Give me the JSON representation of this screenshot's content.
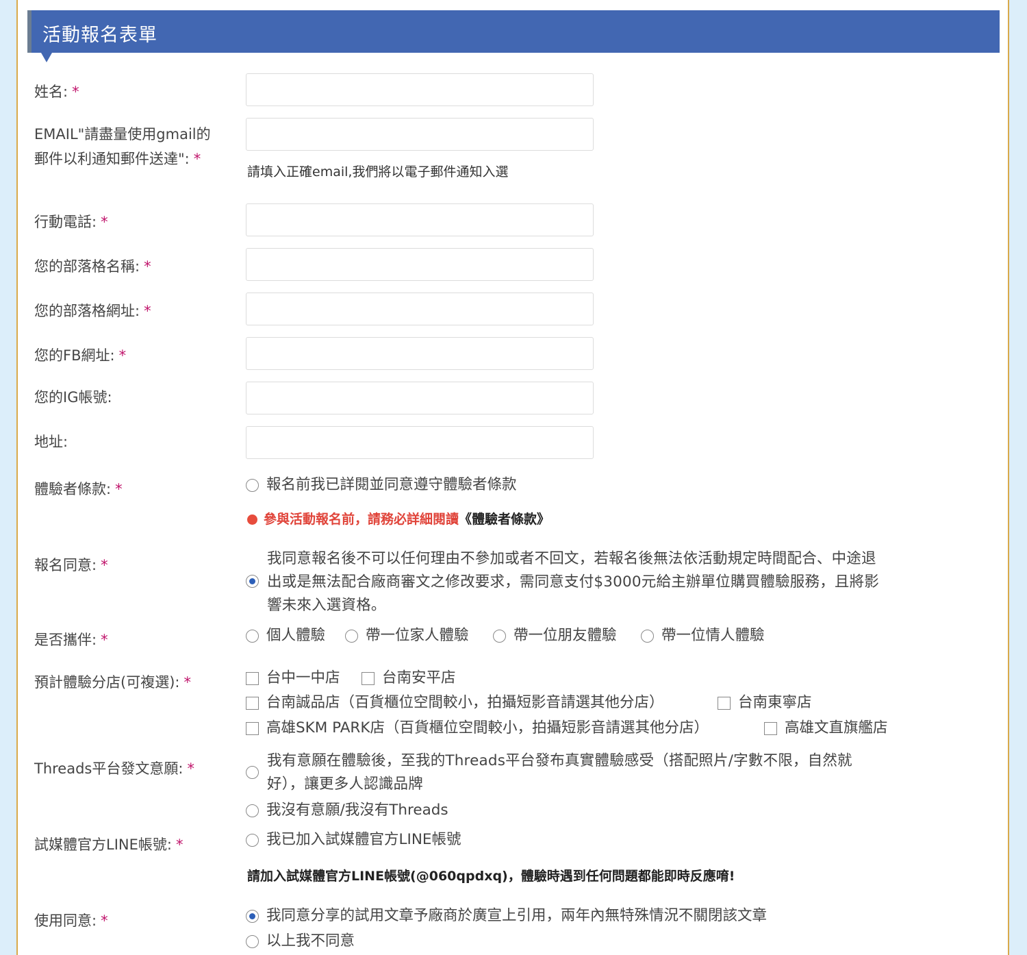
{
  "form": {
    "title": "活動報名表單",
    "required_mark": "*",
    "fields": {
      "name": {
        "label": "姓名:"
      },
      "email": {
        "label_line1": "EMAIL\"請盡量使用gmail的",
        "label_line2": "郵件以利通知郵件送達\":",
        "help": "請填入正確email,我們將以電子郵件通知入選"
      },
      "phone": {
        "label": "行動電話:"
      },
      "blog_name": {
        "label": "您的部落格名稱:"
      },
      "blog_url": {
        "label": "您的部落格網址:"
      },
      "fb_url": {
        "label": "您的FB網址:"
      },
      "ig": {
        "label": "您的IG帳號:"
      },
      "address": {
        "label": "地址:"
      }
    },
    "terms": {
      "label": "體驗者條款:",
      "option": "報名前我已詳閱並同意遵守體驗者條款",
      "warning": "參與活動報名前，請務必詳細閱讀",
      "link": "《體驗者條款》",
      "checked": false
    },
    "consent": {
      "label": "報名同意:",
      "line1": "我同意報名後不可以任何理由不參加或者不回文，若報名後無法依活動規定時間配合、中途退",
      "line2": "出或是無法配合廠商審文之修改要求，需同意支付$3000元給主辦單位購買體驗服務，且將影",
      "line3": "響未來入選資格。",
      "checked": true
    },
    "companion": {
      "label": "是否攜伴:",
      "options": [
        "個人體驗",
        "帶一位家人體驗",
        "帶一位朋友體驗",
        "帶一位情人體驗"
      ]
    },
    "stores": {
      "label": "預計體驗分店(可複選):",
      "options": [
        "台中一中店",
        "台南安平店",
        "台南誠品店（百貨櫃位空間較小，拍攝短影音請選其他分店）",
        "台南東寧店",
        "高雄SKM PARK店（百貨櫃位空間較小，拍攝短影音請選其他分店）",
        "高雄文直旗艦店"
      ]
    },
    "threads": {
      "label": "Threads平台發文意願:",
      "option1_line1": "我有意願在體驗後，至我的Threads平台發布真實體驗感受（搭配照片/字數不限，自然就",
      "option1_line2": "好），讓更多人認識品牌",
      "option2": "我沒有意願/我沒有Threads"
    },
    "line": {
      "label": "試媒體官方LINE帳號:",
      "option": "我已加入試媒體官方LINE帳號",
      "note": "請加入試媒體官方LINE帳號(@060qpdxq)，體驗時遇到任何問題都能即時反應唷!"
    },
    "usage": {
      "label": "使用同意:",
      "option1": "我同意分享的試用文章予廠商於廣宣上引用，兩年內無特殊情況不關閉該文章",
      "option2": "以上我不同意",
      "checked_index": 0
    }
  }
}
